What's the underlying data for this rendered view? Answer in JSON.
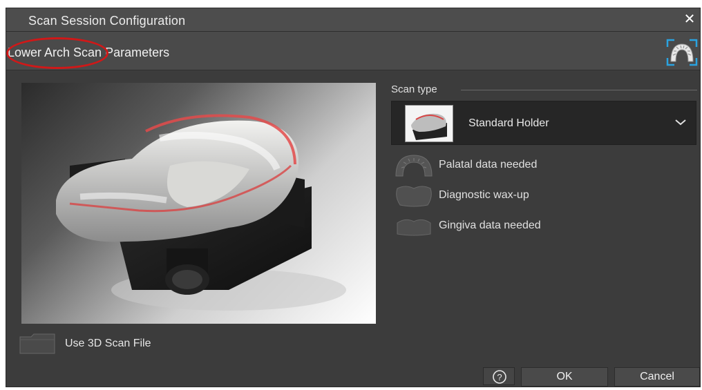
{
  "window": {
    "title": "Scan Session Configuration",
    "close_glyph": "✕"
  },
  "section": {
    "title": "Lower Arch Scan Parameters",
    "arch_icon": "dental-arch-icon",
    "annotation_color": "#d01818"
  },
  "scan_type": {
    "legend": "Scan type",
    "selected": "Standard Holder",
    "thumbnail_icon": "model-holder-thumbnail"
  },
  "options": [
    {
      "label": "Palatal data needed",
      "icon": "palatal-arch-icon"
    },
    {
      "label": "Diagnostic wax-up",
      "icon": "wax-up-icon"
    },
    {
      "label": "Gingiva data needed",
      "icon": "gingiva-icon"
    }
  ],
  "file": {
    "label": "Use 3D Scan File",
    "icon": "folder-icon"
  },
  "buttons": {
    "help_glyph": "?",
    "ok": "OK",
    "cancel": "Cancel"
  },
  "colors": {
    "dialog_bg": "#3c3c3c",
    "header_bg": "#4d4d4d",
    "accent_blue": "#2aa3e0"
  }
}
